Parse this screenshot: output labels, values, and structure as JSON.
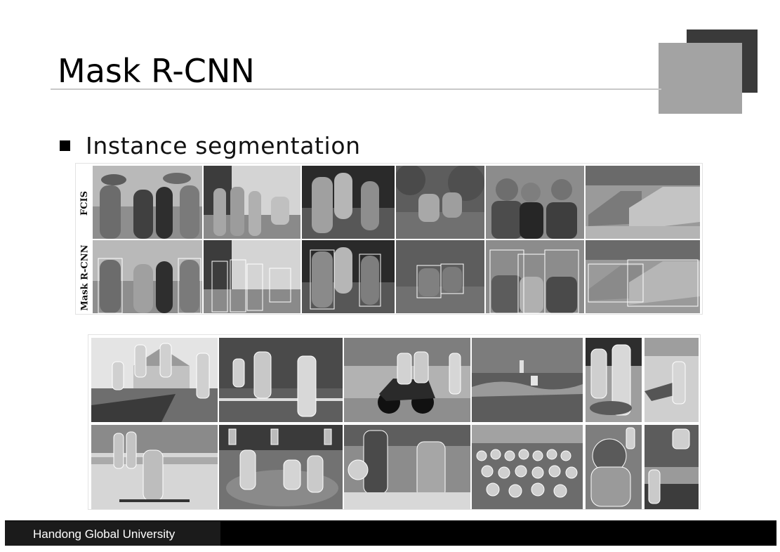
{
  "slide": {
    "title": "Mask R-CNN",
    "bullet": "Instance segmentation"
  },
  "figure_top": {
    "row_labels": [
      "FCIS",
      "Mask R-CNN"
    ],
    "rows": 2,
    "columns": 6
  },
  "figure_bottom": {
    "rows": 2,
    "columns": 6
  },
  "footer": {
    "text": "Handong Global University"
  },
  "colors": {
    "title_rule": "#c8c8c8",
    "deco_dark": "#3a3a3a",
    "deco_light": "#a3a3a3",
    "footer_bar": "#000000"
  }
}
